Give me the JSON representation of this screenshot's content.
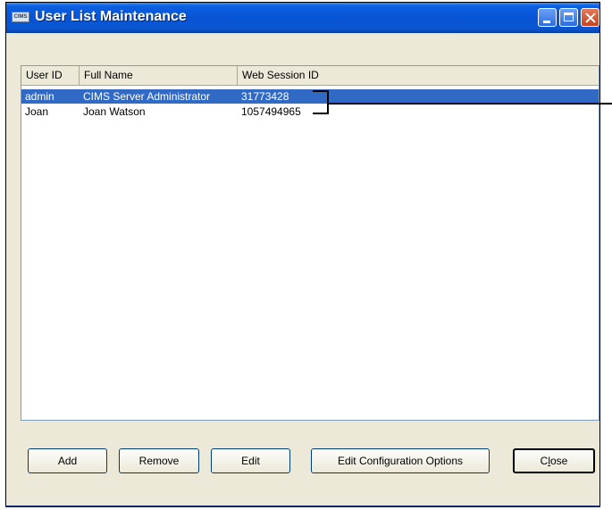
{
  "window": {
    "title": "User List Maintenance",
    "app_icon_text": "CIMS"
  },
  "list": {
    "columns": [
      "User ID",
      "Full Name",
      "Web Session ID"
    ],
    "rows": [
      {
        "user_id": "admin",
        "full_name": "CIMS Server Administrator",
        "session_id": "31773428",
        "selected": true
      },
      {
        "user_id": "Joan",
        "full_name": "Joan Watson",
        "session_id": "1057494965",
        "selected": false
      }
    ]
  },
  "buttons": {
    "add": "Add",
    "remove": "Remove",
    "edit": "Edit",
    "edit_config": "Edit Configuration Options",
    "close_prefix": "C",
    "close_mnemonic": "l",
    "close_suffix": "ose"
  },
  "colors": {
    "titlebar": "#0754d6",
    "selection": "#316ac5",
    "dialog_bg": "#ece9d8"
  }
}
